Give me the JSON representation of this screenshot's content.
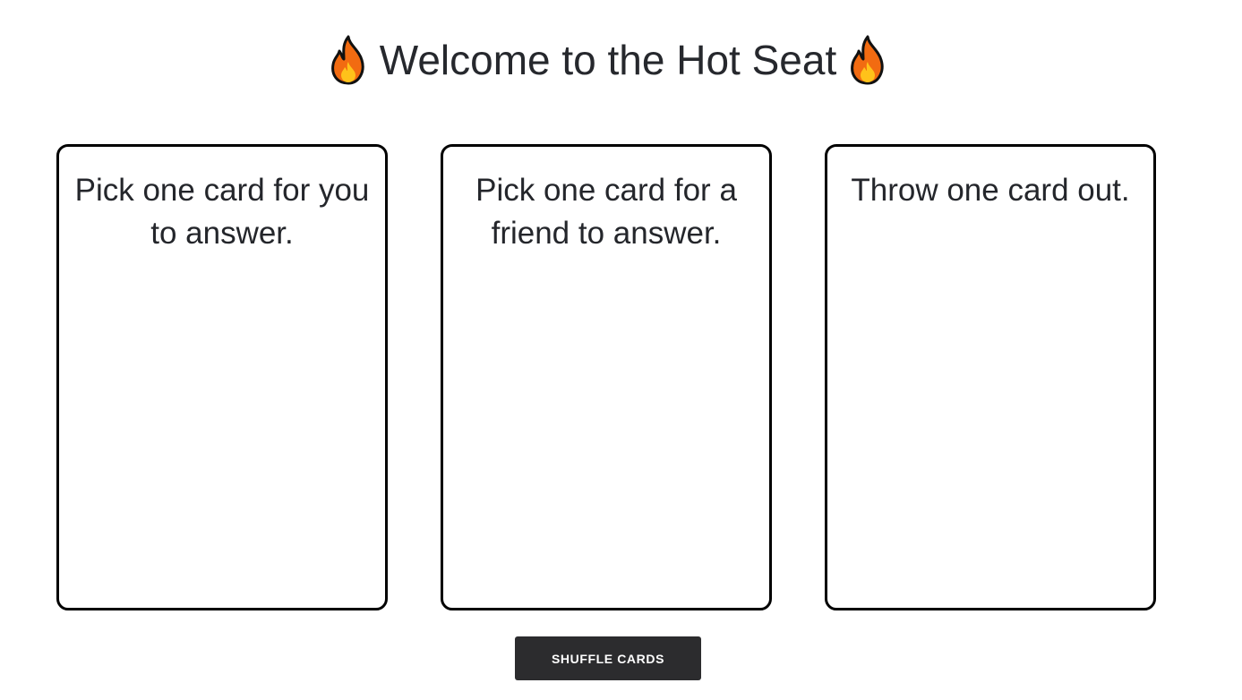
{
  "header": {
    "title": "Welcome to the Hot Seat",
    "left_icon": "fire-icon",
    "right_icon": "fire-icon"
  },
  "cards": [
    {
      "text": "Pick one card for you to answer."
    },
    {
      "text": "Pick one card for a friend to answer."
    },
    {
      "text": "Throw one card out."
    }
  ],
  "actions": {
    "shuffle_label": "SHUFFLE CARDS"
  },
  "colors": {
    "button_bg": "#2c2c2e",
    "card_border": "#000000",
    "fire_outer": "#f26b11",
    "fire_inner": "#ffc21a"
  }
}
